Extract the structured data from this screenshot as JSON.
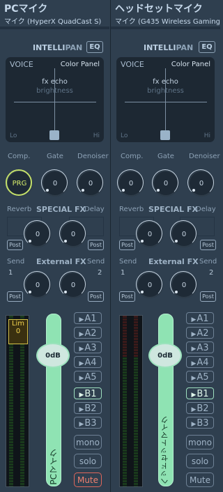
{
  "strips": [
    {
      "title": "PCマイク",
      "device": "マイク (HyperX QuadCast S)",
      "intellipan": {
        "intelli": "INTELLI",
        "pan": "PAN",
        "eq": "EQ"
      },
      "panel": {
        "voice": "VOICE",
        "color_panel": "Color Panel",
        "fx_echo": "fx echo",
        "brightness": "brightness",
        "lo": "Lo",
        "hi": "Hi"
      },
      "dynamics": {
        "comp_label": "Comp.",
        "gate_label": "Gate",
        "denoiser_label": "Denoiser",
        "comp_value": "PRG",
        "gate_value": "0",
        "denoiser_value": "0"
      },
      "special_fx": {
        "reverb_label": "Reverb",
        "title": "SPECIAL FX",
        "delay_label": "Delay",
        "reverb_value": "0",
        "delay_value": "0",
        "post": "Post"
      },
      "external_fx": {
        "send_label": "Send",
        "title": "External FX",
        "num1": "1",
        "num2": "2",
        "send1_value": "0",
        "send2_value": "0",
        "post": "Post"
      },
      "meter": {
        "lim_label": "Lim",
        "lim_value": "0"
      },
      "fader": {
        "value": "0dB",
        "strip_name": "PCマイク"
      },
      "buses": [
        {
          "label": "A1",
          "active": false
        },
        {
          "label": "A2",
          "active": false
        },
        {
          "label": "A3",
          "active": false
        },
        {
          "label": "A4",
          "active": false
        },
        {
          "label": "A5",
          "active": false
        },
        {
          "label": "B1",
          "active": true
        },
        {
          "label": "B2",
          "active": false
        },
        {
          "label": "B3",
          "active": false
        }
      ],
      "modes": {
        "mono": "mono",
        "solo": "solo",
        "mute": "Mute",
        "mute_active": true
      }
    },
    {
      "title": "ヘッドセットマイク",
      "device": "マイク (G435 Wireless Gaming",
      "intellipan": {
        "intelli": "INTELLI",
        "pan": "PAN",
        "eq": "EQ"
      },
      "panel": {
        "voice": "VOICE",
        "color_panel": "Color Panel",
        "fx_echo": "fx echo",
        "brightness": "brightness",
        "lo": "Lo",
        "hi": "Hi"
      },
      "dynamics": {
        "comp_label": "Comp.",
        "gate_label": "Gate",
        "denoiser_label": "Denoiser",
        "comp_value": "0",
        "gate_value": "0",
        "denoiser_value": "0"
      },
      "special_fx": {
        "reverb_label": "Reverb",
        "title": "SPECIAL FX",
        "delay_label": "Delay",
        "reverb_value": "0",
        "delay_value": "0",
        "post": "Post"
      },
      "external_fx": {
        "send_label": "Send",
        "title": "External FX",
        "num1": "1",
        "num2": "2",
        "send1_value": "0",
        "send2_value": "0",
        "post": "Post"
      },
      "meter": {
        "lim_label": "",
        "lim_value": ""
      },
      "fader": {
        "value": "0dB",
        "strip_name": "ヘッドセットマイク"
      },
      "buses": [
        {
          "label": "A1",
          "active": false
        },
        {
          "label": "A2",
          "active": false
        },
        {
          "label": "A3",
          "active": false
        },
        {
          "label": "A4",
          "active": false
        },
        {
          "label": "A5",
          "active": false
        },
        {
          "label": "B1",
          "active": true
        },
        {
          "label": "B2",
          "active": false
        },
        {
          "label": "B3",
          "active": false
        }
      ],
      "modes": {
        "mono": "mono",
        "solo": "solo",
        "mute": "Mute",
        "mute_active": false
      }
    }
  ],
  "colors": {
    "background": "#2f3f4f",
    "fader_track": "#8fe3b3",
    "mute_active": "#e0675b",
    "comp_prg": "#c4e06a",
    "bus_active": "#9ee0c0"
  }
}
